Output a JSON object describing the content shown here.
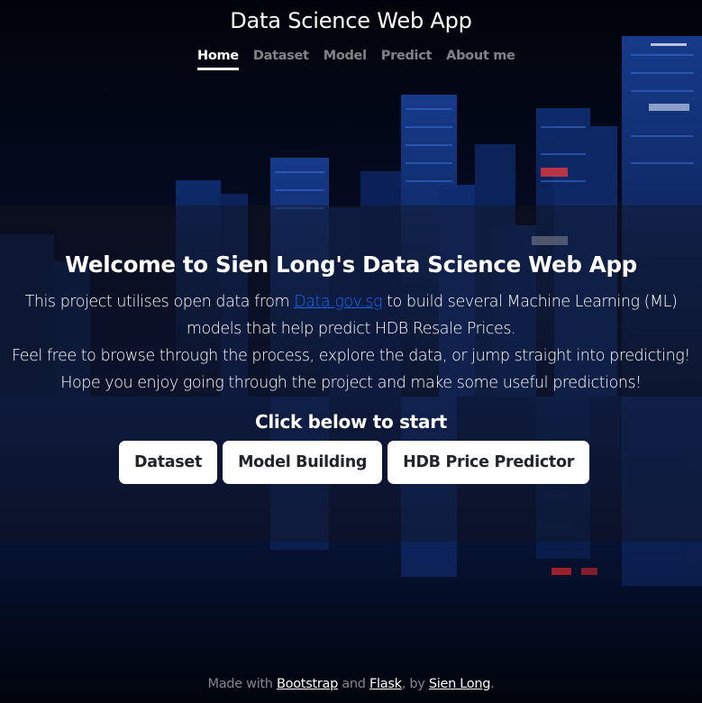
{
  "header": {
    "brand": "Data Science Web App",
    "nav": [
      {
        "label": "Home",
        "active": true
      },
      {
        "label": "Dataset",
        "active": false
      },
      {
        "label": "Model",
        "active": false
      },
      {
        "label": "Predict",
        "active": false
      },
      {
        "label": "About me",
        "active": false
      }
    ]
  },
  "main": {
    "heading": "Welcome to Sien Long's Data Science Web App",
    "intro": {
      "line1_before": "This project utilises open data from ",
      "line1_link": "Data.gov.sg",
      "line1_after": " to build several Machine Learning (ML) models that help predict HDB Resale Prices.",
      "line2": "Feel free to browse through the process, explore the data, or jump straight into predicting!",
      "line3": "Hope you enjoy going through the project and make some useful predictions!"
    },
    "cta_heading": "Click below to start",
    "buttons": {
      "dataset": "Dataset",
      "model_building": "Model Building",
      "predictor": "HDB Price Predictor"
    }
  },
  "footer": {
    "prefix": "Made with ",
    "bootstrap": "Bootstrap",
    "and": " and ",
    "flask": "Flask",
    "by": ", by ",
    "author": "Sien Long",
    "suffix": "."
  },
  "colors": {
    "background": "#020817",
    "link": "#0d6efd",
    "button_bg": "#ffffff",
    "button_text": "#212529"
  },
  "icons": {
    "background": "city-skyline-night-image"
  }
}
